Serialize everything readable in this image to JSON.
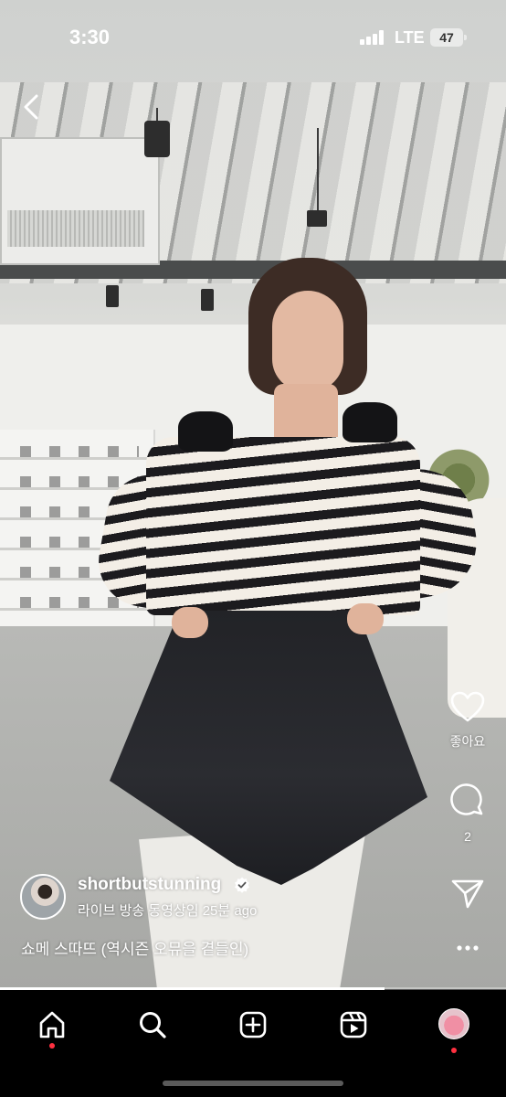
{
  "status_bar": {
    "time": "3:30",
    "network": "LTE",
    "battery": "47"
  },
  "post": {
    "username": "shortbutstunning",
    "meta": "라이브 방송 동영상임 25분 ago",
    "caption": "쇼메 스따뜨 (역시즌 오뮤을 곁들인)",
    "progress": 0.76
  },
  "actions": {
    "like_label": "좋아요",
    "comment_count": "2"
  },
  "icons": {
    "back": "chevron-left-icon",
    "like": "heart-icon",
    "comment": "comment-icon",
    "share": "send-icon",
    "more": "more-icon",
    "home": "home-icon",
    "search": "search-icon",
    "create": "plus-square-icon",
    "reels": "reels-icon"
  },
  "colors": {
    "notification_dot": "#ff3040"
  }
}
